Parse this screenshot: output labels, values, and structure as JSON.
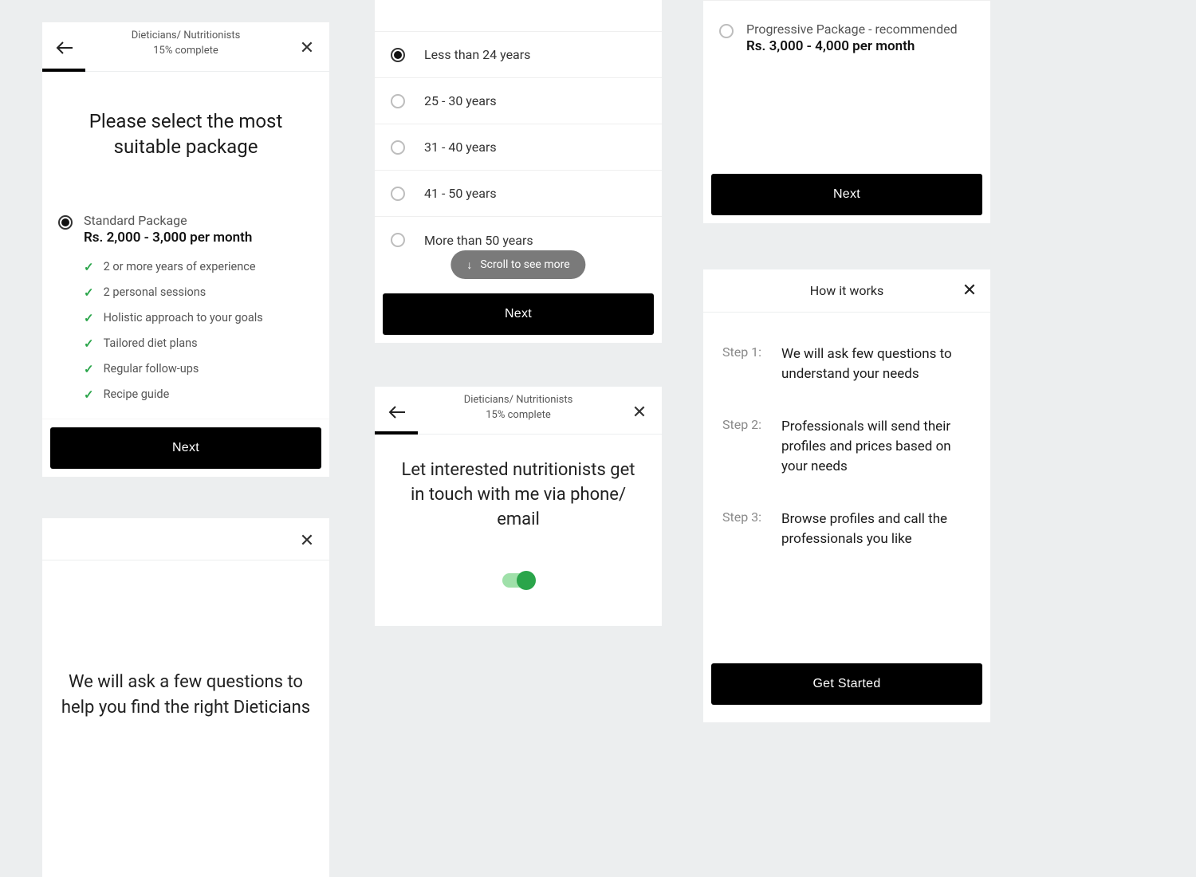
{
  "s1": {
    "header_title": "Dieticians/ Nutritionists",
    "progress_label": "15% complete",
    "question": "Please select the most suitable package",
    "option": {
      "name": "Standard Package",
      "price": "Rs. 2,000 - 3,000 per month",
      "features": [
        "2 or more years of experience",
        "2 personal sessions",
        "Holistic approach to your goals",
        "Tailored diet plans",
        "Regular follow-ups",
        "Recipe guide"
      ]
    },
    "next": "Next"
  },
  "s2": {
    "text": "We will ask a few questions to help you find the right Dieticians"
  },
  "s3": {
    "options": [
      "Less than 24 years",
      "25 - 30 years",
      "31 - 40 years",
      "41 - 50 years",
      "More than 50 years"
    ],
    "scroll_hint": "Scroll to see more",
    "next": "Next"
  },
  "s4": {
    "header_title": "Dieticians/ Nutritionists",
    "progress_label": "15% complete",
    "question": "Let interested nutritionists get in touch with me via phone/ email"
  },
  "s5": {
    "name": "Progressive Package - recommended",
    "price": "Rs. 3,000 - 4,000 per month",
    "next": "Next"
  },
  "s6": {
    "title": "How it works",
    "steps": [
      {
        "label": "Step 1:",
        "text": "We will ask few questions to understand your needs"
      },
      {
        "label": "Step 2:",
        "text": "Professionals will send their profiles and prices based on your needs"
      },
      {
        "label": "Step 3:",
        "text": "Browse profiles and call the professionals you like"
      }
    ],
    "cta": "Get Started"
  }
}
